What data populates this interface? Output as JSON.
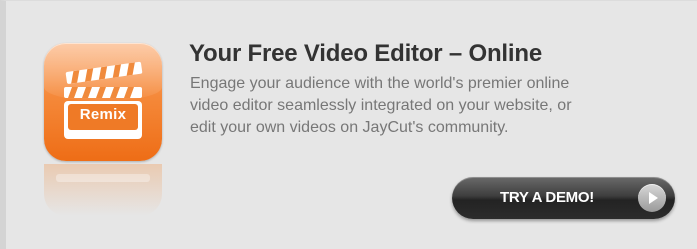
{
  "promo": {
    "app_icon": {
      "icon": "clapperboard-icon",
      "label": "Remix",
      "accent_color": "#f5893a"
    },
    "headline": "Your Free Video Editor – Online",
    "description_lines": [
      "Engage your audience with the world's premier online",
      "video editor seamlessly integrated on your website, or",
      "edit your own videos on JayCut's community."
    ],
    "cta": {
      "label": "TRY A DEMO!",
      "icon": "play-icon"
    }
  },
  "colors": {
    "background": "#e6e6e6",
    "headline": "#333333",
    "body_text": "#777777",
    "button": "#2c2c2c"
  }
}
